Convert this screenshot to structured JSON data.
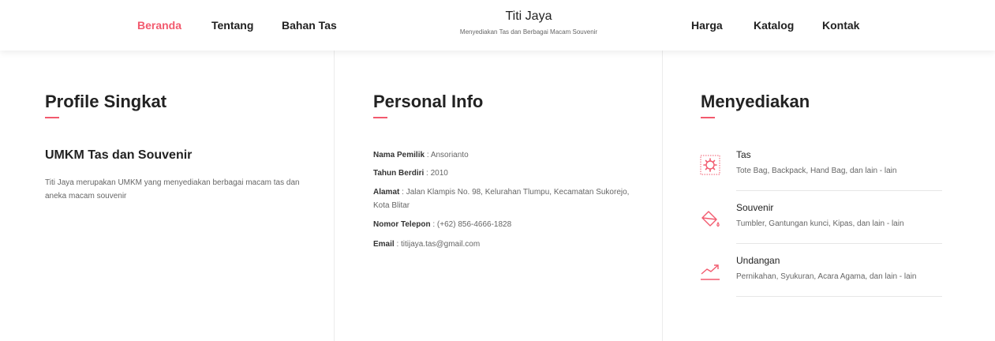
{
  "nav": {
    "left": [
      "Beranda",
      "Tentang",
      "Bahan Tas"
    ],
    "right": [
      "Harga",
      "Katalog",
      "Kontak"
    ],
    "active": "Beranda"
  },
  "brand": {
    "title": "Titi Jaya",
    "subtitle": "Menyediakan Tas dan Berbagai Macam Souvenir"
  },
  "colors": {
    "accent": "#f25a6e",
    "text": "#222222",
    "muted": "#666666"
  },
  "profile": {
    "title": "Profile Singkat",
    "heading": "UMKM Tas dan Souvenir",
    "text": "Titi Jaya merupakan UMKM yang menyediakan berbagai macam tas dan aneka macam souvenir"
  },
  "personal": {
    "title": "Personal Info",
    "items": [
      {
        "label": "Nama Pemilik",
        "value": " : Ansorianto"
      },
      {
        "label": "Tahun Berdiri",
        "value": " : 2010"
      },
      {
        "label": "Alamat",
        "value": " : Jalan Klampis No. 98, Kelurahan Tlumpu, Kecamatan Sukorejo, Kota Blitar"
      },
      {
        "label": "Nomor Telepon",
        "value": " : (+62) 856-4666-1828"
      },
      {
        "label": "Email",
        "value": " : titijaya.tas@gmail.com"
      }
    ]
  },
  "services": {
    "title": "Menyediakan",
    "items": [
      {
        "title": "Tas",
        "desc": "Tote Bag, Backpack, Hand Bag, dan lain - lain",
        "icon": "gear-icon"
      },
      {
        "title": "Souvenir",
        "desc": "Tumbler, Gantungan kunci, Kipas, dan lain - lain",
        "icon": "paint-bucket-icon"
      },
      {
        "title": "Undangan",
        "desc": "Pernikahan, Syukuran, Acara Agama, dan lain - lain",
        "icon": "trend-up-icon"
      }
    ]
  }
}
